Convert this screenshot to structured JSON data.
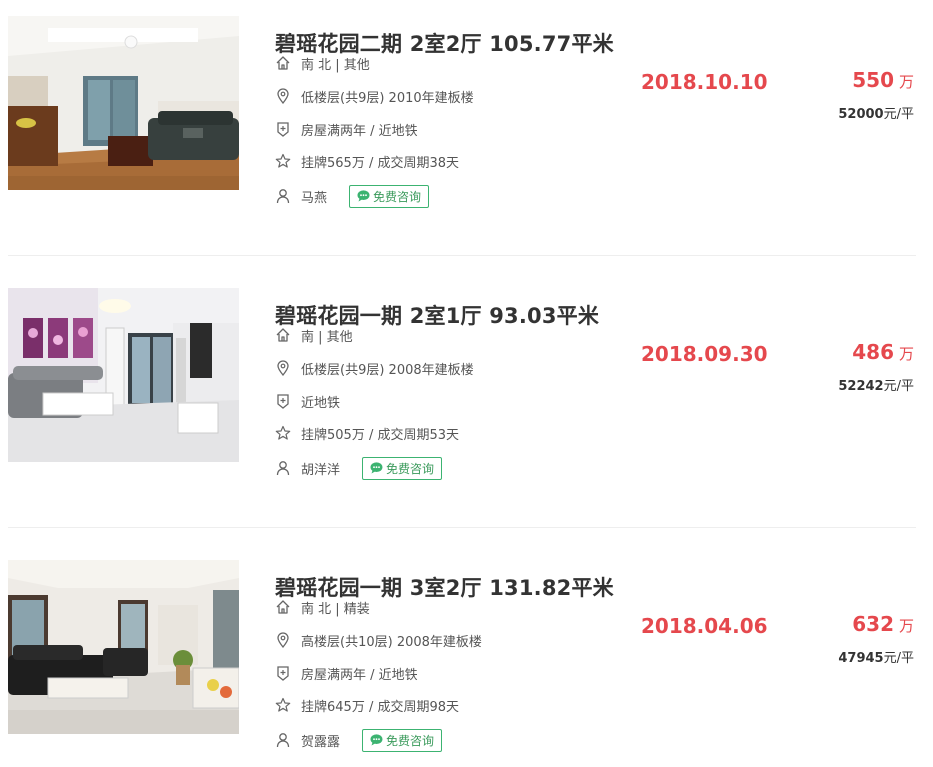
{
  "listings": [
    {
      "title": "碧瑶花园二期 2室2厅 105.77平米",
      "house_info": "南 北 | 其他",
      "position_info": "低楼层(共9层) 2010年建板楼",
      "tags": "房屋满两年 / 近地铁",
      "deal_cycle": "挂牌565万 / 成交周期38天",
      "agent_name": "马燕",
      "consult_label": "免费咨询",
      "deal_date": "2018.10.10",
      "total_price": "550",
      "total_unit": "万",
      "unit_price": "52000",
      "unit_price_suffix": "元/平"
    },
    {
      "title": "碧瑶花园一期 2室1厅 93.03平米",
      "house_info": "南 | 其他",
      "position_info": "低楼层(共9层) 2008年建板楼",
      "tags": "近地铁",
      "deal_cycle": "挂牌505万 / 成交周期53天",
      "agent_name": "胡洋洋",
      "consult_label": "免费咨询",
      "deal_date": "2018.09.30",
      "total_price": "486",
      "total_unit": "万",
      "unit_price": "52242",
      "unit_price_suffix": "元/平"
    },
    {
      "title": "碧瑶花园一期 3室2厅 131.82平米",
      "house_info": "南 北 | 精装",
      "position_info": "高楼层(共10层) 2008年建板楼",
      "tags": "房屋满两年 / 近地铁",
      "deal_cycle": "挂牌645万 / 成交周期98天",
      "agent_name": "贺露露",
      "consult_label": "免费咨询",
      "deal_date": "2018.04.06",
      "total_price": "632",
      "total_unit": "万",
      "unit_price": "47945",
      "unit_price_suffix": "元/平"
    }
  ],
  "icons": {
    "house": "house-icon",
    "location": "location-pin-icon",
    "tag": "shield-tag-icon",
    "deal": "star-icon",
    "agent": "person-icon",
    "chat": "chat-bubble-icon"
  },
  "colors": {
    "price_red": "#e5484d",
    "consult_green": "#3cb371"
  }
}
